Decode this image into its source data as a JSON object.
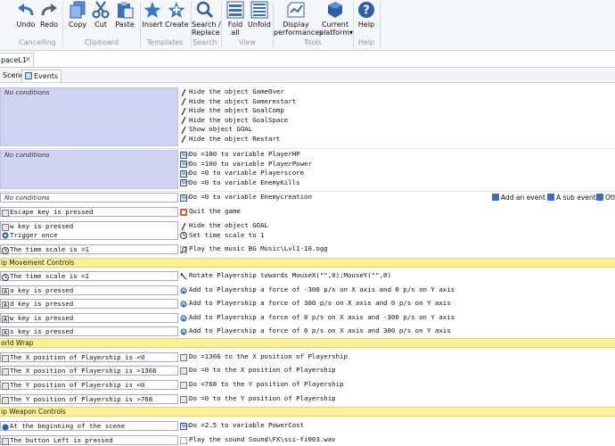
{
  "ribbon": {
    "buttons": {
      "undo": "Undo",
      "redo": "Redo",
      "copy": "Copy",
      "cut": "Cut",
      "paste": "Paste",
      "insert": "Insert",
      "create": "Create",
      "search": "Search /\nReplace",
      "fold_all": "Fold all",
      "unfold": "Unfold",
      "display": "Display\nperformances",
      "platform": "Current\nplatform▾",
      "help": "Help",
      "help2": "Help"
    },
    "groups": {
      "cancelling": "Cancelling",
      "clipboard": "Clipboard",
      "templates": "Templates",
      "search": "Search",
      "view": "View",
      "tools": "Tools"
    }
  },
  "tabs": {
    "document": "paceL1",
    "close": "×",
    "scene": "Scene",
    "events": "Events"
  },
  "add_bar": {
    "add_event": "Add an event",
    "add_sub_event": "A sub event",
    "other": "Oth"
  },
  "events": [
    {
      "conditions": [
        "No conditions"
      ],
      "actions": [
        "Hide the object GameOver",
        "Hide the object Gamerestart",
        "Hide the object GoalComp",
        "Hide the object GoalSpace",
        "Show object GOAL",
        "Hide the object Restart"
      ]
    },
    {
      "conditions": [
        "No conditions"
      ],
      "actions": [
        "Do =100 to variable PlayerHP",
        "Do =100 to variable PlayerPower",
        "Do =0 to variable Playerscore",
        "Do =0 to variable EnemyKills"
      ]
    },
    {
      "conditions": [
        "No conditions"
      ],
      "actions": [
        "Do =0 to variable Enemycreation"
      ]
    },
    {
      "conditions": [
        "Escape key is pressed"
      ],
      "actions": [
        "Quit the game"
      ]
    },
    {
      "conditions": [
        "w key is pressed",
        "Trigger once"
      ],
      "actions": [
        "Hide the object GOAL",
        "Set time scale to 1"
      ]
    },
    {
      "conditions": [
        "The time scale is =1"
      ],
      "actions": [
        "Play the music BG Music\\Lvl1-10.ogg"
      ]
    },
    {
      "comment": "ip Movement Controls"
    },
    {
      "conditions": [
        "The time scale is =1"
      ],
      "actions": [
        "Rotate Playership towards MouseX(\"\",0);MouseY(\"\",0)"
      ]
    },
    {
      "conditions": [
        "a key is pressed"
      ],
      "actions": [
        "Add to Playership a force of -300 p/s on X axis and 0 p/s on Y axis"
      ]
    },
    {
      "conditions": [
        "d key is pressed"
      ],
      "actions": [
        "Add to Playership a force of 300 p/s on X axis and 0 p/s on Y axis"
      ]
    },
    {
      "conditions": [
        "w key is pressed"
      ],
      "actions": [
        "Add to Playership a force of 0 p/s on X axis and -300 p/s on Y axis"
      ]
    },
    {
      "conditions": [
        "s key is pressed"
      ],
      "actions": [
        "Add to Playership a force of 0 p/s on X axis and 300 p/s on Y axis"
      ]
    },
    {
      "comment": "orld Wrap"
    },
    {
      "conditions": [
        "The X position of Playership is <0"
      ],
      "actions": [
        "Do =1366 to the X position of Playership"
      ]
    },
    {
      "conditions": [
        "The X position of Playership is >1366"
      ],
      "actions": [
        "Do =0 to the X position of Playership"
      ]
    },
    {
      "conditions": [
        "The Y position of Playership is <0"
      ],
      "actions": [
        "Do =768 to the Y position of Playership"
      ]
    },
    {
      "conditions": [
        "The Y position of Playership is >768"
      ],
      "actions": [
        "Do =0 to the Y position of Playership"
      ]
    },
    {
      "comment": "ip Weapon Controls"
    },
    {
      "conditions": [
        "At the beginning of the scene"
      ],
      "actions": [
        "Do =2.5 to variable PowerCost"
      ]
    },
    {
      "conditions": [
        "The button Left is pressed"
      ],
      "actions": [
        "Play the sound Sound\\FX\\sci-fi003.wav"
      ]
    }
  ]
}
